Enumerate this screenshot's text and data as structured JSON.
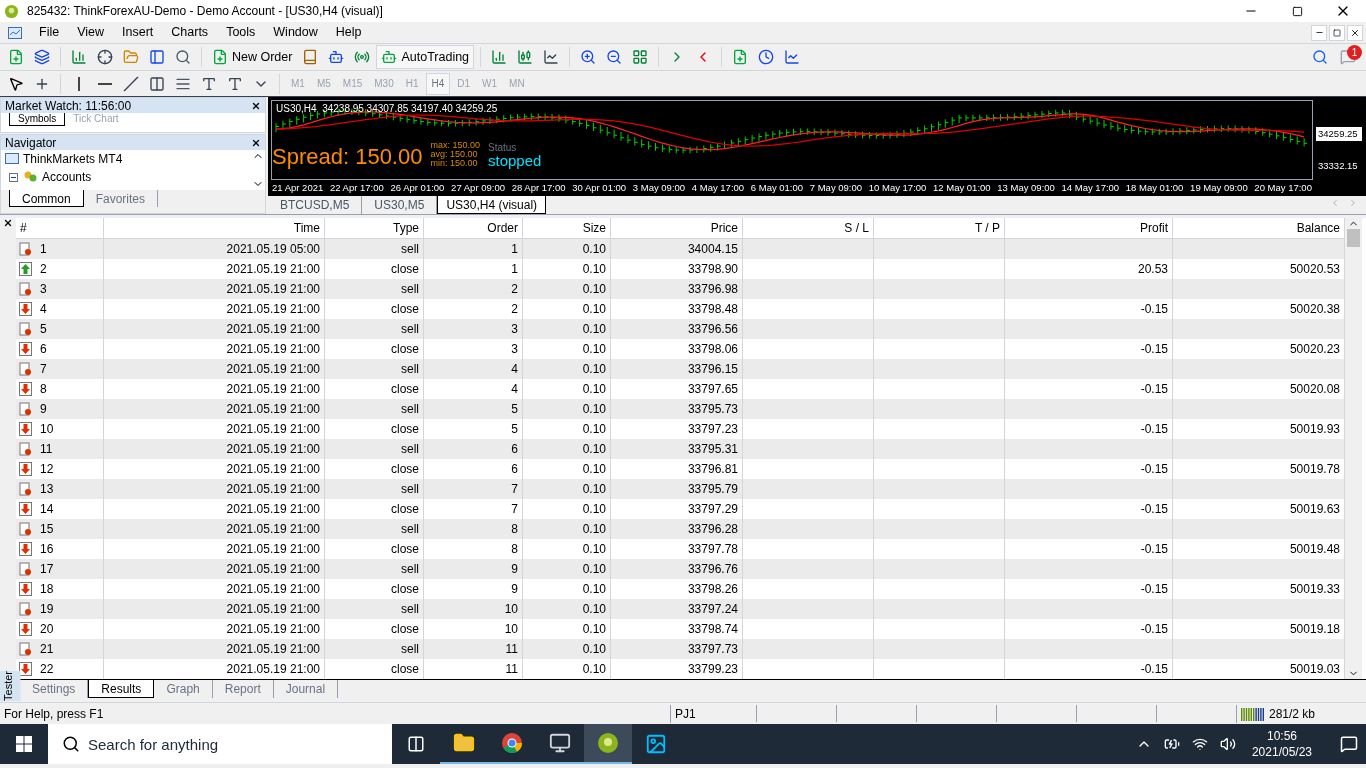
{
  "window": {
    "title": "825432: ThinkForexAU-Demo - Demo Account - [US30,H4 (visual)]"
  },
  "menu": [
    "File",
    "View",
    "Insert",
    "Charts",
    "Tools",
    "Window",
    "Help"
  ],
  "toolbar": {
    "new_order": "New Order",
    "auto_trading": "AutoTrading",
    "notification_count": "1"
  },
  "timeframes": [
    {
      "label": "M1",
      "selected": false
    },
    {
      "label": "M5",
      "selected": false
    },
    {
      "label": "M15",
      "selected": false
    },
    {
      "label": "M30",
      "selected": false
    },
    {
      "label": "H1",
      "selected": false
    },
    {
      "label": "H4",
      "selected": true
    },
    {
      "label": "D1",
      "selected": false
    },
    {
      "label": "W1",
      "selected": false
    },
    {
      "label": "MN",
      "selected": false
    }
  ],
  "market_watch": {
    "title": "Market Watch: 11:56:00",
    "tabs": [
      {
        "label": "Symbols",
        "selected": true
      },
      {
        "label": "Tick Chart",
        "selected": false
      }
    ]
  },
  "navigator": {
    "title": "Navigator",
    "tree": [
      {
        "label": "ThinkMarkets MT4",
        "children": [
          {
            "label": "Accounts",
            "expanded": true
          }
        ]
      }
    ],
    "tabs": [
      {
        "label": "Common",
        "selected": true
      },
      {
        "label": "Favorites",
        "selected": false
      }
    ]
  },
  "chart": {
    "header": "US30,H4  34238.95 34307.85 34197.40 34259.25",
    "spread": "Spread: 150.00",
    "spread_stats": [
      "max: 150.00",
      "avg: 150.00",
      "min: 150.00"
    ],
    "status_label": "Status",
    "status": "stopped",
    "price_labels": [
      "34259.25",
      "33332.15"
    ],
    "time_labels": [
      "21 Apr 2021",
      "22 Apr 17:00",
      "26 Apr 01:00",
      "27 Apr 09:00",
      "28 Apr 17:00",
      "30 Apr 01:00",
      "3 May 09:00",
      "4 May 17:00",
      "6 May 01:00",
      "7 May 09:00",
      "10 May 17:00",
      "12 May 01:00",
      "13 May 09:00",
      "14 May 17:00",
      "18 May 01:00",
      "19 May 09:00",
      "20 May 17:00"
    ]
  },
  "chart_tabs": [
    {
      "label": "BTCUSD,M5",
      "selected": false
    },
    {
      "label": "US30,M5",
      "selected": false
    },
    {
      "label": "US30,H4 (visual)",
      "selected": true
    }
  ],
  "tester": {
    "label": "Tester",
    "columns": [
      "#",
      "Time",
      "Type",
      "Order",
      "Size",
      "Price",
      "S / L",
      "T / P",
      "Profit",
      "Balance"
    ],
    "rows": [
      {
        "kind": "sell",
        "n": "1",
        "time": "2021.05.19 05:00",
        "type": "sell",
        "order": "1",
        "size": "0.10",
        "price": "34004.15"
      },
      {
        "kind": "gain",
        "n": "2",
        "time": "2021.05.19 21:00",
        "type": "close",
        "order": "1",
        "size": "0.10",
        "price": "33798.90",
        "profit": "20.53",
        "balance": "50020.53"
      },
      {
        "kind": "sell",
        "n": "3",
        "time": "2021.05.19 21:00",
        "type": "sell",
        "order": "2",
        "size": "0.10",
        "price": "33796.98"
      },
      {
        "kind": "loss",
        "n": "4",
        "time": "2021.05.19 21:00",
        "type": "close",
        "order": "2",
        "size": "0.10",
        "price": "33798.48",
        "profit": "-0.15",
        "balance": "50020.38"
      },
      {
        "kind": "sell",
        "n": "5",
        "time": "2021.05.19 21:00",
        "type": "sell",
        "order": "3",
        "size": "0.10",
        "price": "33796.56"
      },
      {
        "kind": "loss",
        "n": "6",
        "time": "2021.05.19 21:00",
        "type": "close",
        "order": "3",
        "size": "0.10",
        "price": "33798.06",
        "profit": "-0.15",
        "balance": "50020.23"
      },
      {
        "kind": "sell",
        "n": "7",
        "time": "2021.05.19 21:00",
        "type": "sell",
        "order": "4",
        "size": "0.10",
        "price": "33796.15"
      },
      {
        "kind": "loss",
        "n": "8",
        "time": "2021.05.19 21:00",
        "type": "close",
        "order": "4",
        "size": "0.10",
        "price": "33797.65",
        "profit": "-0.15",
        "balance": "50020.08"
      },
      {
        "kind": "sell",
        "n": "9",
        "time": "2021.05.19 21:00",
        "type": "sell",
        "order": "5",
        "size": "0.10",
        "price": "33795.73"
      },
      {
        "kind": "loss",
        "n": "10",
        "time": "2021.05.19 21:00",
        "type": "close",
        "order": "5",
        "size": "0.10",
        "price": "33797.23",
        "profit": "-0.15",
        "balance": "50019.93"
      },
      {
        "kind": "sell",
        "n": "11",
        "time": "2021.05.19 21:00",
        "type": "sell",
        "order": "6",
        "size": "0.10",
        "price": "33795.31"
      },
      {
        "kind": "loss",
        "n": "12",
        "time": "2021.05.19 21:00",
        "type": "close",
        "order": "6",
        "size": "0.10",
        "price": "33796.81",
        "profit": "-0.15",
        "balance": "50019.78"
      },
      {
        "kind": "sell",
        "n": "13",
        "time": "2021.05.19 21:00",
        "type": "sell",
        "order": "7",
        "size": "0.10",
        "price": "33795.79"
      },
      {
        "kind": "loss",
        "n": "14",
        "time": "2021.05.19 21:00",
        "type": "close",
        "order": "7",
        "size": "0.10",
        "price": "33797.29",
        "profit": "-0.15",
        "balance": "50019.63"
      },
      {
        "kind": "sell",
        "n": "15",
        "time": "2021.05.19 21:00",
        "type": "sell",
        "order": "8",
        "size": "0.10",
        "price": "33796.28"
      },
      {
        "kind": "loss",
        "n": "16",
        "time": "2021.05.19 21:00",
        "type": "close",
        "order": "8",
        "size": "0.10",
        "price": "33797.78",
        "profit": "-0.15",
        "balance": "50019.48"
      },
      {
        "kind": "sell",
        "n": "17",
        "time": "2021.05.19 21:00",
        "type": "sell",
        "order": "9",
        "size": "0.10",
        "price": "33796.76"
      },
      {
        "kind": "loss",
        "n": "18",
        "time": "2021.05.19 21:00",
        "type": "close",
        "order": "9",
        "size": "0.10",
        "price": "33798.26",
        "profit": "-0.15",
        "balance": "50019.33"
      },
      {
        "kind": "sell",
        "n": "19",
        "time": "2021.05.19 21:00",
        "type": "sell",
        "order": "10",
        "size": "0.10",
        "price": "33797.24"
      },
      {
        "kind": "loss",
        "n": "20",
        "time": "2021.05.19 21:00",
        "type": "close",
        "order": "10",
        "size": "0.10",
        "price": "33798.74",
        "profit": "-0.15",
        "balance": "50019.18"
      },
      {
        "kind": "sell",
        "n": "21",
        "time": "2021.05.19 21:00",
        "type": "sell",
        "order": "11",
        "size": "0.10",
        "price": "33797.73"
      },
      {
        "kind": "loss",
        "n": "22",
        "time": "2021.05.19 21:00",
        "type": "close",
        "order": "11",
        "size": "0.10",
        "price": "33799.23",
        "profit": "-0.15",
        "balance": "50019.03"
      }
    ],
    "tabs": [
      {
        "label": "Settings",
        "selected": false
      },
      {
        "label": "Results",
        "selected": true
      },
      {
        "label": "Graph",
        "selected": false
      },
      {
        "label": "Report",
        "selected": false
      },
      {
        "label": "Journal",
        "selected": false
      }
    ]
  },
  "status_bar": {
    "help": "For Help, press F1",
    "profile": "PJ1",
    "traffic": "281/2 kb"
  },
  "taskbar": {
    "search_placeholder": "Search for anything",
    "time": "10:56",
    "date": "2021/05/23"
  }
}
